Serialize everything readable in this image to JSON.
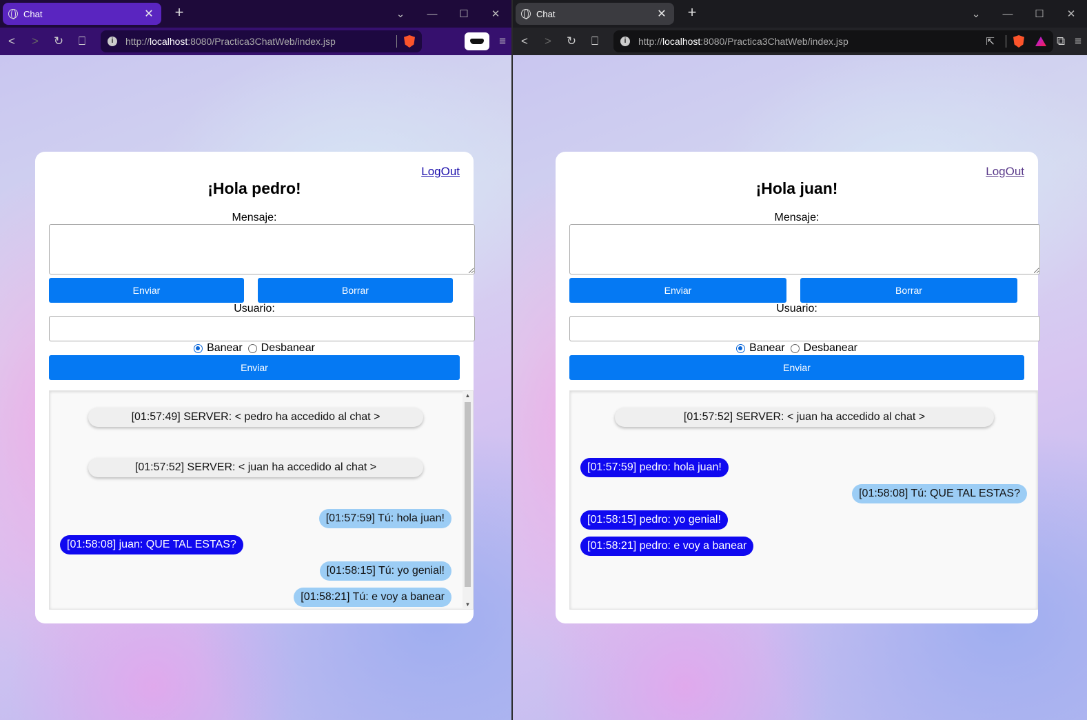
{
  "left_window": {
    "tab_title": "Chat",
    "url_scheme_prefix": "http://",
    "url_host": "localhost",
    "url_rest": ":8080/Practica3ChatWeb/index.jsp",
    "logout_label": "LogOut",
    "greeting": "¡Hola pedro!",
    "message_label": "Mensaje:",
    "send_label": "Enviar",
    "clear_label": "Borrar",
    "user_label": "Usuario:",
    "ban_label": "Banear",
    "unban_label": "Desbanear",
    "ban_selected": "Banear",
    "submit_label": "Enviar",
    "messages": [
      {
        "type": "server",
        "text": "[01:57:49] SERVER: < pedro ha accedido al chat >"
      },
      {
        "type": "server",
        "text": "[01:57:52] SERVER: < juan ha accedido al chat >"
      },
      {
        "type": "mine",
        "text": "[01:57:59] Tú: hola juan!"
      },
      {
        "type": "other",
        "text": "[01:58:08] juan: QUE TAL ESTAS?"
      },
      {
        "type": "mine",
        "text": "[01:58:15] Tú: yo genial!"
      },
      {
        "type": "mine",
        "text": "[01:58:21] Tú: e voy a banear"
      }
    ]
  },
  "right_window": {
    "tab_title": "Chat",
    "url_scheme_prefix": "http://",
    "url_host": "localhost",
    "url_rest": ":8080/Practica3ChatWeb/index.jsp",
    "logout_label": "LogOut",
    "greeting": "¡Hola juan!",
    "message_label": "Mensaje:",
    "send_label": "Enviar",
    "clear_label": "Borrar",
    "user_label": "Usuario:",
    "ban_label": "Banear",
    "unban_label": "Desbanear",
    "ban_selected": "Banear",
    "submit_label": "Enviar",
    "messages": [
      {
        "type": "server",
        "text": "[01:57:52] SERVER: < juan ha accedido al chat >"
      },
      {
        "type": "other",
        "text": "[01:57:59] pedro: hola juan!"
      },
      {
        "type": "mine",
        "text": "[01:58:08] Tú: QUE TAL ESTAS?"
      },
      {
        "type": "other",
        "text": "[01:58:15] pedro: yo genial!"
      },
      {
        "type": "other",
        "text": "[01:58:21] pedro: e voy a banear"
      }
    ]
  },
  "icons": {
    "tab_favicon": "globe-icon",
    "tab_close": "close-icon",
    "new_tab": "plus-icon",
    "back": "back-arrow-icon",
    "forward": "forward-arrow-icon",
    "reload": "reload-icon",
    "bookmark": "bookmark-icon",
    "site_info": "info-icon",
    "shields": "brave-shield-icon",
    "rewards": "brave-rewards-icon",
    "vpn": "vpn-icon",
    "menu": "hamburger-menu-icon",
    "share": "share-icon",
    "extensions": "puzzle-icon"
  },
  "colors": {
    "button_blue": "#0579f3",
    "own_bubble": "#9ccdf5",
    "other_bubble": "#1009f0",
    "server_bubble": "#efefef",
    "left_tab_active": "#5a25c0",
    "left_toolbar": "#36106e",
    "right_toolbar": "#232327"
  }
}
